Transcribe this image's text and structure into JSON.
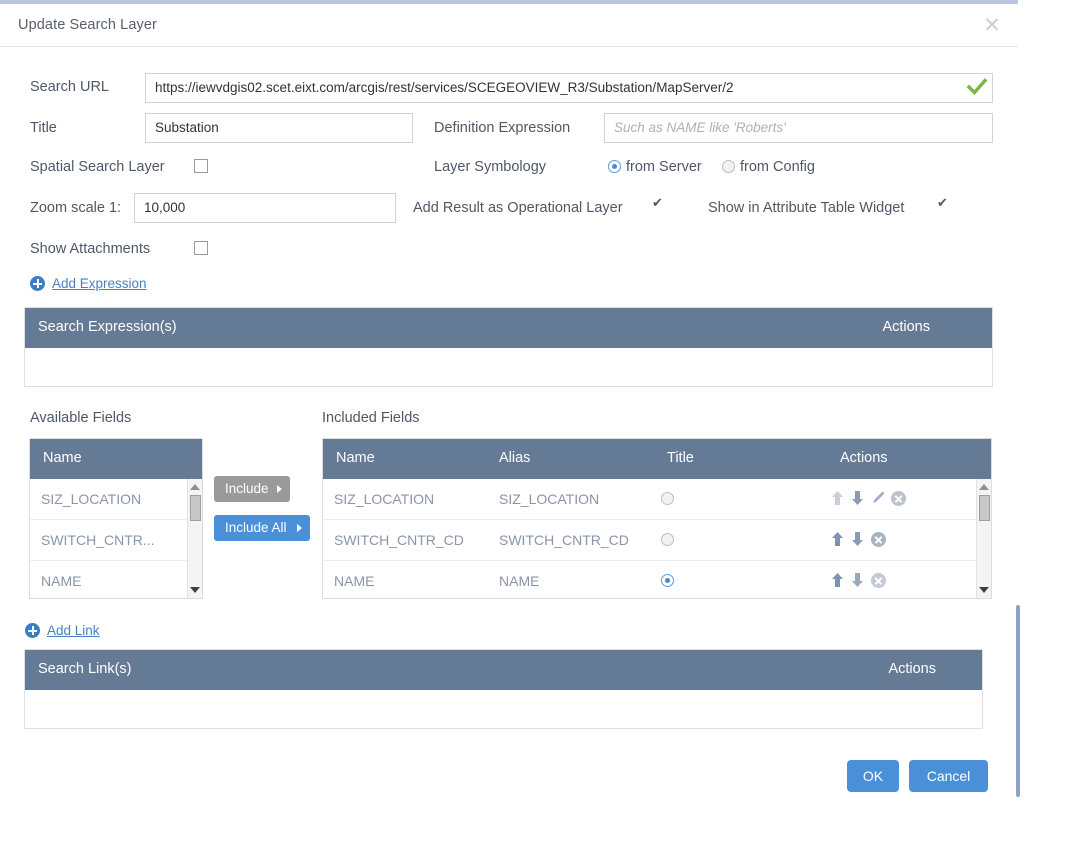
{
  "dialog": {
    "title": "Update Search Layer",
    "close_icon": "close-icon"
  },
  "form": {
    "search_url_label": "Search URL",
    "search_url_value": "https://iewvdgis02.scet.eixt.com/arcgis/rest/services/SCEGEOVIEW_R3/Substation/MapServer/2",
    "url_valid_icon": "check-icon",
    "title_label": "Title",
    "title_value": "Substation",
    "definition_expression_label": "Definition Expression",
    "definition_expression_placeholder": "Such as NAME like 'Roberts'",
    "spatial_search_layer_label": "Spatial Search Layer",
    "spatial_search_layer_checked": false,
    "layer_symbology_label": "Layer Symbology",
    "symbology_options": [
      {
        "label": "from Server",
        "selected": true
      },
      {
        "label": "from Config",
        "selected": false
      }
    ],
    "zoom_scale_label": "Zoom scale 1:",
    "zoom_scale_value": "10,000",
    "add_result_label": "Add Result as Operational Layer",
    "add_result_checked": true,
    "show_attribute_table_label": "Show in Attribute Table Widget",
    "show_attribute_table_checked": true,
    "show_attachments_label": "Show Attachments",
    "show_attachments_checked": false
  },
  "expressions": {
    "add_link_label": "Add Expression",
    "add_icon": "plus-circle-icon",
    "header_label": "Search Expression(s)",
    "header_actions": "Actions",
    "rows": []
  },
  "fields": {
    "available_label": "Available Fields",
    "included_label": "Included Fields",
    "available_header": "Name",
    "available_rows": [
      {
        "name": "SIZ_LOCATION"
      },
      {
        "name": "SWITCH_CNTR..."
      },
      {
        "name": "NAME"
      }
    ],
    "included_headers": [
      "Name",
      "Alias",
      "Title",
      "Actions"
    ],
    "included_rows": [
      {
        "name": "SIZ_LOCATION",
        "alias": "SIZ_LOCATION",
        "title_selected": false,
        "actions": [
          "move-up-icon",
          "move-down-icon",
          "edit-pencil-icon",
          "remove-icon"
        ]
      },
      {
        "name": "SWITCH_CNTR_CD",
        "alias": "SWITCH_CNTR_CD",
        "title_selected": false,
        "actions": [
          "move-up-icon",
          "move-down-icon",
          "remove-icon"
        ]
      },
      {
        "name": "NAME",
        "alias": "NAME",
        "title_selected": true,
        "actions": [
          "move-up-icon",
          "move-down-icon",
          "remove-icon"
        ]
      }
    ],
    "include_button": "Include",
    "include_all_button": "Include All"
  },
  "links": {
    "add_link_label": "Add Link",
    "add_icon": "plus-circle-icon",
    "header_label": "Search Link(s)",
    "header_actions": "Actions",
    "rows": []
  },
  "footer": {
    "ok_label": "OK",
    "cancel_label": "Cancel"
  },
  "colors": {
    "header_slate": "#657b95",
    "accent_blue": "#4a90d9",
    "link_blue": "#4a7fc1",
    "valid_green": "#7ab648",
    "label_gray": "#4f5866",
    "row_text": "#8a95a6",
    "titlebar_top_border": "#b9c4e0"
  }
}
